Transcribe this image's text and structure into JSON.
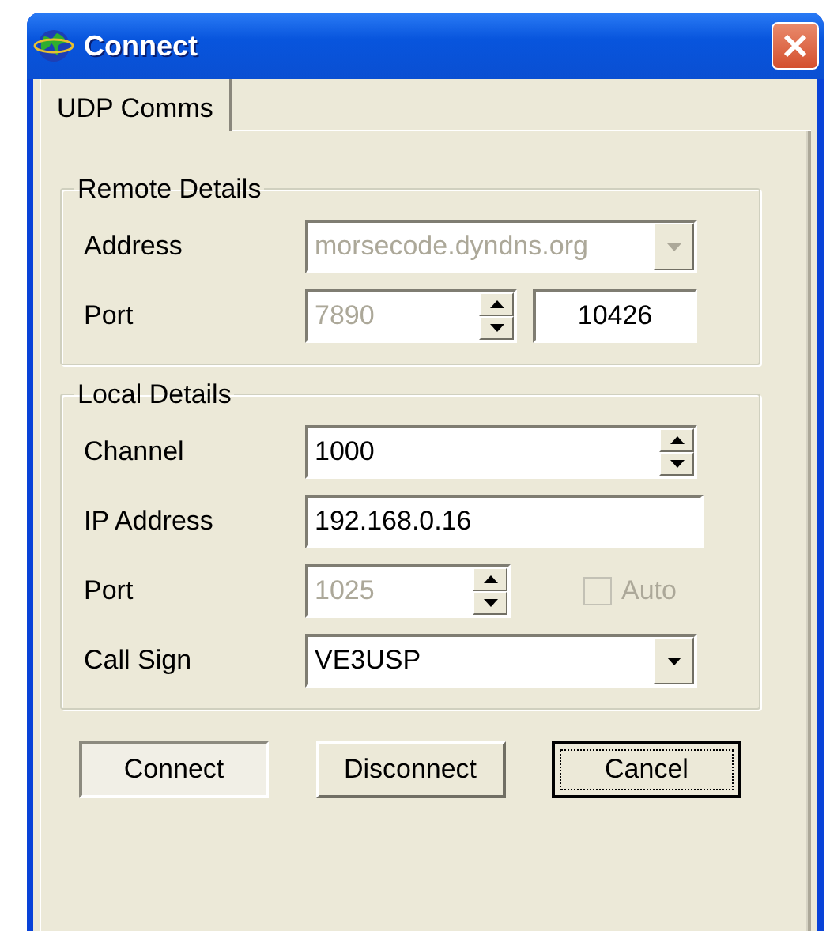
{
  "window": {
    "title": "Connect"
  },
  "tabs": [
    {
      "label": "UDP Comms",
      "selected": true
    }
  ],
  "remote_details": {
    "title": "Remote Details",
    "rows": [
      {
        "kind": "combo",
        "label": "Address",
        "value": "morsecode.dyndns.org",
        "disabled": true
      },
      {
        "kind": "spin_pair",
        "label": "Port",
        "value": "7890",
        "disabled": true,
        "extra_value": "10426"
      }
    ]
  },
  "local_details": {
    "title": "Local Details",
    "rows": [
      {
        "kind": "spin",
        "label": "Channel",
        "value": "1000",
        "disabled": false
      },
      {
        "kind": "text",
        "label": "IP Address",
        "value": "192.168.0.16",
        "disabled": false
      },
      {
        "kind": "spin_check",
        "label": "Port",
        "value": "1025",
        "disabled": true,
        "check_label": "Auto",
        "checked": false,
        "check_disabled": true
      },
      {
        "kind": "combo",
        "label": "Call Sign",
        "value": "VE3USP",
        "disabled": false
      }
    ]
  },
  "buttons": [
    {
      "label": "Connect",
      "pressed": true,
      "default": false
    },
    {
      "label": "Disconnect",
      "pressed": false,
      "default": false
    },
    {
      "label": "Cancel",
      "pressed": false,
      "default": true
    }
  ]
}
